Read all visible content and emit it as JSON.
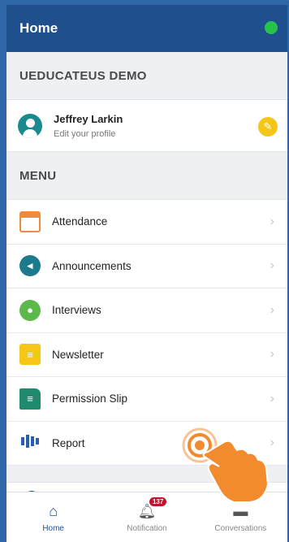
{
  "header": {
    "title": "Home",
    "status_color": "#27c24c"
  },
  "org_section": {
    "title": "UEDUCATEUS DEMO"
  },
  "profile": {
    "name": "Jeffrey Larkin",
    "subtitle": "Edit your profile"
  },
  "menu_section": {
    "title": "MENU"
  },
  "menu": {
    "items": [
      {
        "label": "Attendance",
        "icon": "calendar-icon"
      },
      {
        "label": "Announcements",
        "icon": "megaphone-icon"
      },
      {
        "label": "Interviews",
        "icon": "chat-icon"
      },
      {
        "label": "Newsletter",
        "icon": "newsletter-icon"
      },
      {
        "label": "Permission Slip",
        "icon": "document-icon"
      },
      {
        "label": "Report",
        "icon": "bar-chart-icon"
      }
    ]
  },
  "tabbar": {
    "home_label": "Home",
    "notification_label": "Notification",
    "notification_count": "137",
    "conversations_label": "Conversations"
  },
  "colors": {
    "primary": "#1f4f8c",
    "accent": "#f08a3c",
    "badge": "#c8102e"
  }
}
